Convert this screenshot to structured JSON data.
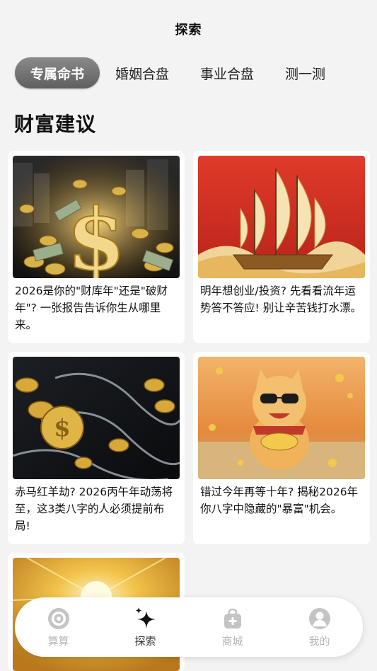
{
  "header": {
    "title": "探索"
  },
  "tabs": [
    {
      "label": "专属命书",
      "active": true
    },
    {
      "label": "婚姻合盘",
      "active": false
    },
    {
      "label": "事业合盘",
      "active": false
    },
    {
      "label": "测一测",
      "active": false
    }
  ],
  "section": {
    "title": "财富建议"
  },
  "cards": [
    {
      "title": "2026是你的\"财库年\"还是\"破财年\"? 一张报告告诉你生从哪里来。",
      "image": "gold-dollar-sign-coins"
    },
    {
      "title": "明年想创业/投资? 先看看流年运势答不答应! 别让辛苦钱打水漂。",
      "image": "golden-sailing-ship"
    },
    {
      "title": "赤马红羊劫? 2026丙午年动荡将至，这3类八字的人必须提前布局!",
      "image": "gold-coins-in-water"
    },
    {
      "title": "错过今年再等十年? 揭秘2026年你八字中隐藏的\"暴富\"机会。",
      "image": "fortune-cat-with-gold"
    },
    {
      "title": "",
      "image": "golden-sunburst"
    }
  ],
  "nav": {
    "items": [
      {
        "label": "算算",
        "icon": "target-icon",
        "active": false
      },
      {
        "label": "探索",
        "icon": "sparkle-icon",
        "active": true
      },
      {
        "label": "商城",
        "icon": "shop-bag-icon",
        "active": false
      },
      {
        "label": "我的",
        "icon": "user-icon",
        "active": false
      }
    ]
  },
  "colors": {
    "background": "#f3f3f3",
    "tab_active_bg": "#6e6e6e",
    "nav_inactive": "#b7b7b7",
    "text": "#111111"
  }
}
